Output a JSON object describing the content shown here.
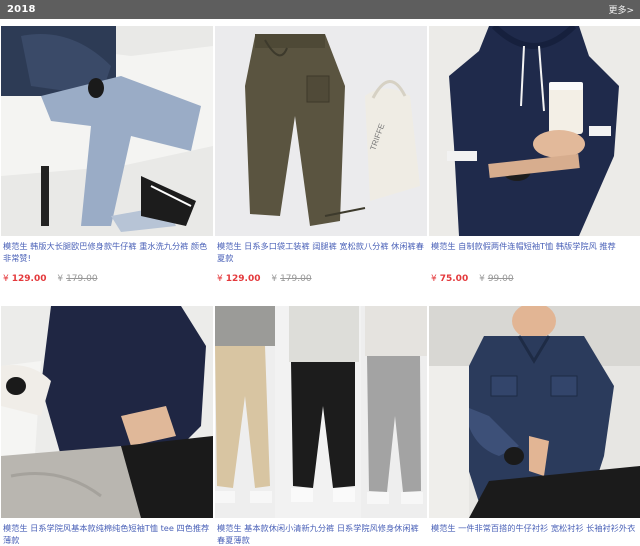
{
  "header": {
    "year": "2018",
    "more_label": "更多>"
  },
  "products": [
    {
      "title": "模范生 韩版大长腿欧巴修身款牛仔裤 重水洗九分裤 颜色非常赞!",
      "price": "129.00",
      "original_price": "179.00",
      "currency": "¥",
      "image_icon": "denim-jeans-photo"
    },
    {
      "title": "模范生 日系多口袋工装裤 阔腿裤 宽松款八分裤 休闲裤春夏款",
      "price": "129.00",
      "original_price": "179.00",
      "currency": "¥",
      "image_icon": "cargo-pants-photo"
    },
    {
      "title": "模范生 自制款假两件连帽短袖T恤 韩版学院风 推荐",
      "price": "75.00",
      "original_price": "99.00",
      "currency": "¥",
      "image_icon": "hooded-tee-photo"
    },
    {
      "title": "模范生 日系学院风基本款纯棉纯色短袖T恤 tee 四色推荐薄款",
      "image_icon": "navy-tee-photo"
    },
    {
      "title": "模范生 基本款休闲小清新九分裤 日系学院风修身休闲裤春夏薄款",
      "image_icon": "slim-trousers-photo"
    },
    {
      "title": "模范生 一件非常百搭的牛仔衬衫 宽松衬衫 长袖衬衫外衣",
      "image_icon": "denim-shirt-photo"
    }
  ],
  "colors": {
    "title_link": "#4b62b8",
    "price_now": "#e4393c",
    "topbar": "#5e5e5e"
  }
}
